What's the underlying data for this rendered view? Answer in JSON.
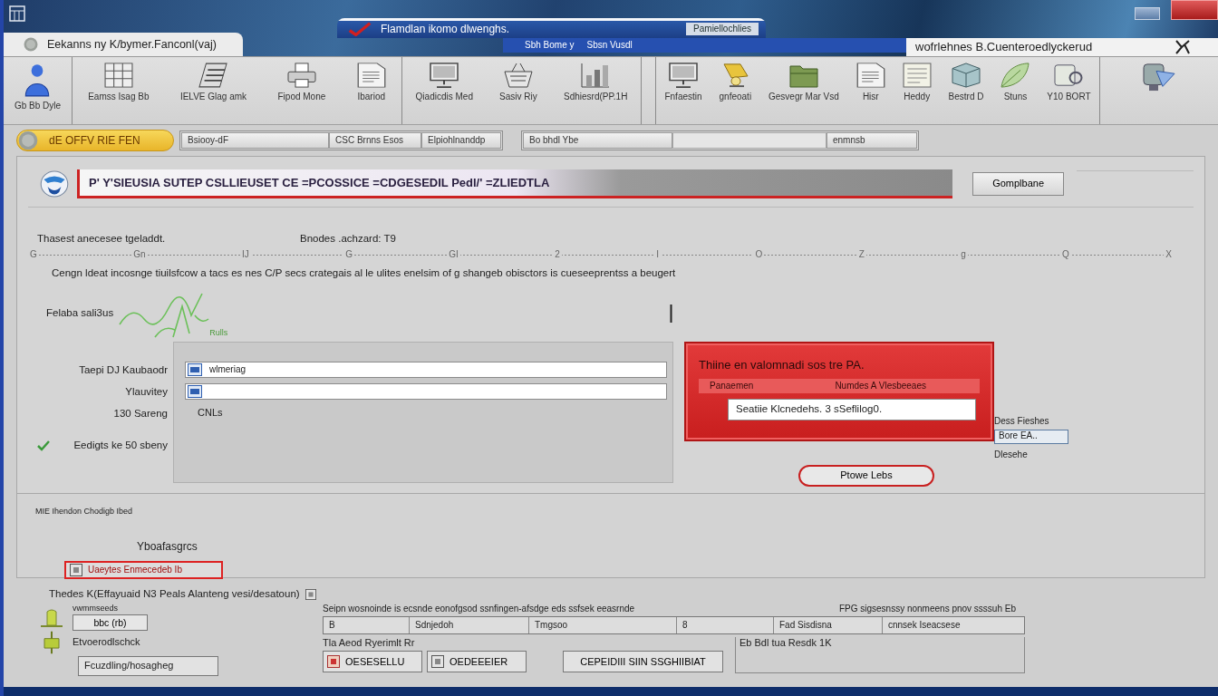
{
  "window": {
    "tab_title": "Eekanns ny K/bymer.Fanconl(vaj)",
    "banner_title": "Flamdlan ikomo dlwenghs.",
    "banner_subtitle": "Pamiellochlies",
    "banner_tabs": [
      "Sbh Bome y",
      "Sbsn Vusdl"
    ],
    "address": "wofrlehnes B.Cuenteroedlyckerud"
  },
  "ribbon": {
    "groups": [
      {
        "items": [
          {
            "label": "Gb Bb Dyle"
          }
        ]
      },
      {
        "items": [
          {
            "label": "Eamss Isag Bb"
          },
          {
            "label": "IELVE Glag amk"
          },
          {
            "label": "Fipod Mone"
          },
          {
            "label": "Ibariod"
          }
        ]
      },
      {
        "items": [
          {
            "label": "Qiadicdis Med"
          },
          {
            "label": "Sasiv Riy"
          },
          {
            "label": "Sdhiesrd(PP.1H"
          }
        ]
      },
      {
        "items": [
          {
            "label": "Fnfaestin"
          },
          {
            "label": "gnfeoati"
          },
          {
            "label": "Gesvegr Mar Vsd"
          },
          {
            "label": "Hisr"
          },
          {
            "label": "Heddy"
          },
          {
            "label": "Bestrd D"
          },
          {
            "label": "Stuns"
          },
          {
            "label": "Y10 BORT"
          }
        ]
      }
    ]
  },
  "toolbar": {
    "filter": "dE OFFV RIE FEN",
    "field_groups": [
      {
        "fields": [
          {
            "kind": "text",
            "value": "Bsiooy-dF"
          },
          {
            "kind": "text",
            "value": "CSC Brnns Esos"
          },
          {
            "kind": "text",
            "value": "Elpiohlnanddp"
          }
        ]
      },
      {
        "fields": [
          {
            "kind": "text",
            "value": "Bo bhdl Ybe"
          },
          {
            "kind": "blank"
          },
          {
            "kind": "text",
            "value": "enmnsb"
          }
        ]
      }
    ]
  },
  "main": {
    "header": {
      "title": "P' Y'SIEUSIA SUTEP CSLLIEUSET CE =PCOSSICE =CDGESEDIL Pedl/' =ZLIEDTLA",
      "button": "Gomplbane"
    },
    "scale": {
      "left_label": "Thasest anecesee tgeladdt.",
      "center_label": "Bnodes .achzard: T9",
      "marks": [
        "G",
        "Gn",
        "IJ",
        "G",
        "GI",
        "2",
        "I",
        "O",
        "Z",
        "g",
        "Q",
        "X"
      ]
    },
    "description": "Cengn ldeat incosnge tiuilsfcow a tacs es nes C/P secs crategais al le ulites enelsim of g shangeb obisctors is cueseeprentss a beugert",
    "sketch": {
      "label": "Felaba sali3us",
      "note": "Rulls"
    },
    "form": {
      "rows": [
        {
          "label": "Taepi DJ Kaubaodr",
          "kind": "input",
          "value": "wlmeriag"
        },
        {
          "label": "Ylauvitey",
          "kind": "input"
        },
        {
          "label": "130 Sareng",
          "kind": "text",
          "value": "CNLs"
        },
        {
          "label": "Eedigts ke 50 sbeny",
          "kind": "check",
          "checked": true
        }
      ]
    },
    "alert": {
      "title": "Thiine en valomnadi sos tre PA.",
      "labels": [
        "Panaemen",
        "Numdes A Vlesbeeaes"
      ],
      "value": "Seatiie Klcnedehs. 3 sSeflilog0.",
      "button": "Ptowe Lebs"
    },
    "side": {
      "label": "Dess Fieshes",
      "value": "Bore EA..",
      "note": "Dlesehe"
    }
  },
  "lower": {
    "caption": "MIE Ihendon Chodigb Ibed",
    "title": "Yboafasgrcs",
    "field": "Uaeytes Enmecedeb Ib"
  },
  "bottom": {
    "heading": "Thedes K(Effayuaid N3 Peals Alanteng vesi/desatoun)",
    "subheading": "vwmmseeds",
    "button": "bbc (rb)",
    "label": "Etvoerodlschck",
    "field": "Fcuzdling/hosagheg",
    "captions": [
      "Seipn wosnoinde is ecsnde eonofgsod ssnfingen-afsdge eds ssfsek eeasrnde",
      "FPG sigsesnssy nonmeens pnov ssssuh Eb"
    ],
    "fields": [
      {
        "value": "B"
      },
      {
        "value": "Sdnjedoh"
      },
      {
        "value": "Tmgsoo"
      },
      {
        "value": "8"
      },
      {
        "value": "Fad Sisdisna"
      },
      {
        "value": "cnnsek Iseacsese"
      }
    ],
    "note": "Tla Aeod Ryerimlt Rr",
    "buttons": [
      "OESESELLU",
      "OEDEEEIER",
      "CEPEIDIII SIIN SSGHIIBIAT"
    ],
    "status": "Eb Bdl tua Resdk 1K"
  }
}
